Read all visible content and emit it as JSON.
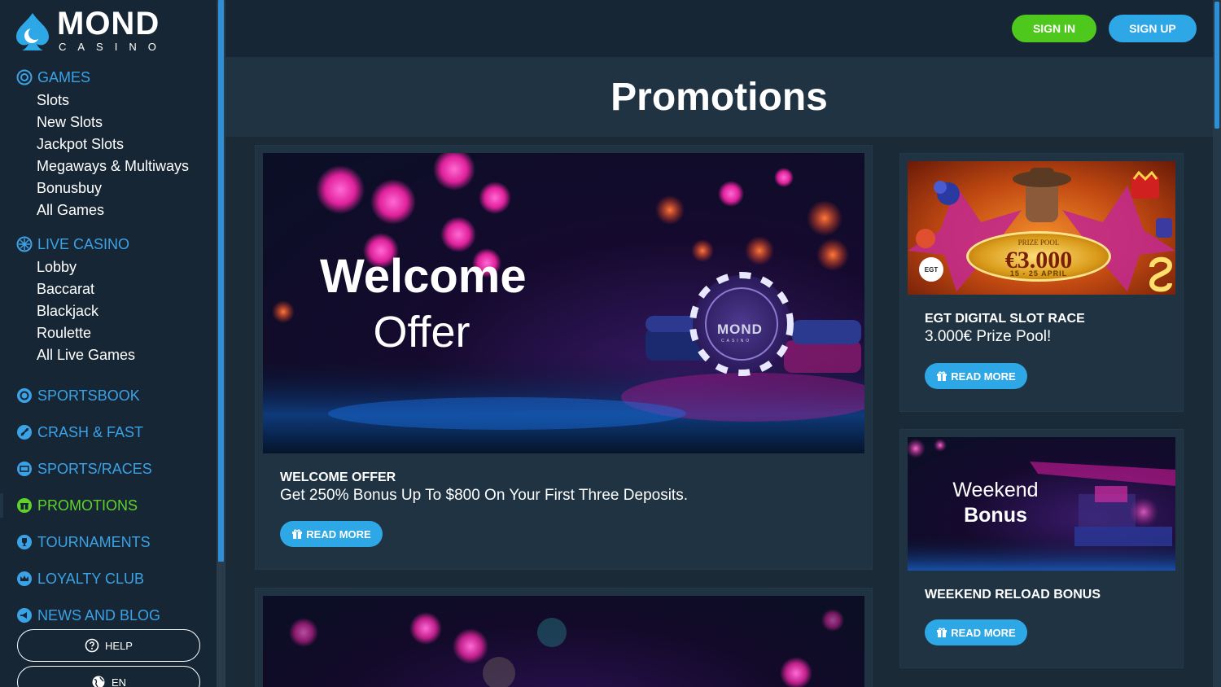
{
  "brand": {
    "name": "MOND",
    "sub": "CASINO"
  },
  "colors": {
    "accent": "#2ea7e6",
    "active": "#4fc81e",
    "bg": "#1a2a37",
    "sidebar": "#172634"
  },
  "header": {
    "signin": "SIGN IN",
    "signup": "SIGN UP"
  },
  "page": {
    "title": "Promotions"
  },
  "sidebar": {
    "games": {
      "label": "GAMES",
      "icon": "games-icon",
      "items": [
        "Slots",
        "New Slots",
        "Jackpot Slots",
        "Megaways & Multiways",
        "Bonusbuy",
        "All Games"
      ]
    },
    "live": {
      "label": "LIVE CASINO",
      "icon": "live-casino-icon",
      "items": [
        "Lobby",
        "Baccarat",
        "Blackjack",
        "Roulette",
        "All Live Games"
      ]
    },
    "sportsbook": {
      "label": "SPORTSBOOK",
      "icon": "sportsbook-icon"
    },
    "crash": {
      "label": "CRASH & FAST",
      "icon": "rocket-icon"
    },
    "sportsraces": {
      "label": "SPORTS/RACES",
      "icon": "ticket-icon"
    },
    "promotions": {
      "label": "PROMOTIONS",
      "icon": "gift-icon"
    },
    "tournaments": {
      "label": "TOURNAMENTS",
      "icon": "trophy-icon"
    },
    "loyalty": {
      "label": "LOYALTY CLUB",
      "icon": "crown-icon"
    },
    "news": {
      "label": "NEWS AND BLOG",
      "icon": "megaphone-icon"
    },
    "help": "HELP",
    "lang": "EN"
  },
  "promos": [
    {
      "banner_line1": "Welcome",
      "banner_line2": "Offer",
      "chip": "MOND",
      "chip_sub": "CASINO",
      "title": "WELCOME OFFER",
      "desc": "Get 250% Bonus Up To $800 On Your First Three Deposits.",
      "button": "READ MORE"
    },
    {
      "prize_caption": "PRIZE POOL",
      "prize_value": "€3.000",
      "prize_dates": "15 - 25 APRIL",
      "egt": "EGT",
      "title": "EGT DIGITAL SLOT RACE",
      "desc": "3.000€ Prize Pool!",
      "button": "READ MORE"
    },
    {
      "banner_line1": "Weekend",
      "banner_line2": "Bonus",
      "title": "WEEKEND RELOAD BONUS",
      "button": "READ MORE"
    }
  ]
}
